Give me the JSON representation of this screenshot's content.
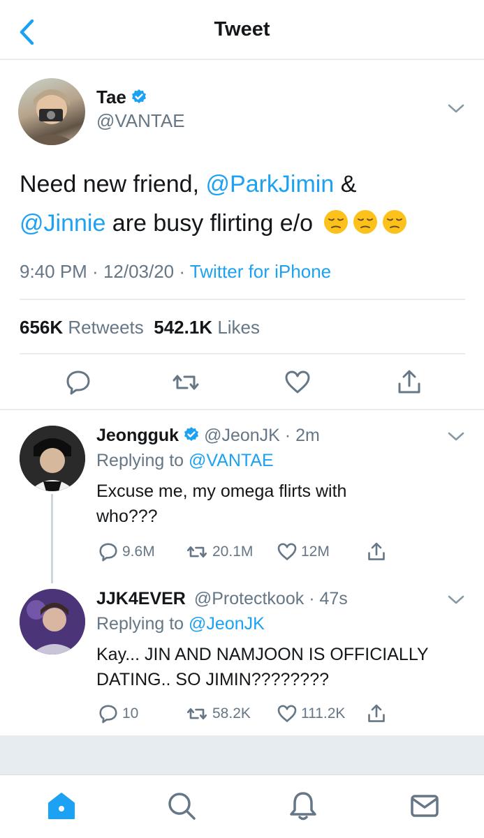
{
  "header": {
    "title": "Tweet"
  },
  "main_tweet": {
    "name": "Tae",
    "handle": "@VANTAE",
    "text_part1": "Need new friend, ",
    "mention1": "@ParkJimin",
    "text_part2": " &",
    "mention2": "@Jinnie",
    "text_part3": " are busy flirting e/o",
    "time": "9:40 PM",
    "date": "12/03/20",
    "source": "Twitter for iPhone",
    "retweets_count": "656K",
    "retweets_label": "Retweets",
    "likes_count": "542.1K",
    "likes_label": "Likes"
  },
  "replies": [
    {
      "name": "Jeongguk",
      "handle": "@JeonJK",
      "time": "2m",
      "replying_label": "Replying to",
      "replying_to": "@VANTAE",
      "text": "Excuse me, my omega flirts with who???",
      "replies": "9.6M",
      "retweets": "20.1M",
      "likes": "12M"
    },
    {
      "name": "JJK4EVER",
      "handle": "@Protectkook",
      "time": "47s",
      "replying_label": "Replying to",
      "replying_to": "@JeonJK",
      "text": "Kay... JIN AND NAMJOON IS OFFICIALLY DATING.. SO JIMIN????????",
      "replies": "10",
      "retweets": "58.2K",
      "likes": "111.2K"
    }
  ],
  "colors": {
    "accent": "#1da1f2",
    "secondary_text": "#657786",
    "border": "#e6ecf0"
  },
  "icons": [
    "back-chevron-icon",
    "verified-badge-icon",
    "chevron-down-icon",
    "reply-icon",
    "retweet-icon",
    "like-icon",
    "share-icon",
    "home-icon",
    "search-icon",
    "notifications-icon",
    "messages-icon",
    "pensive-face-emoji"
  ]
}
